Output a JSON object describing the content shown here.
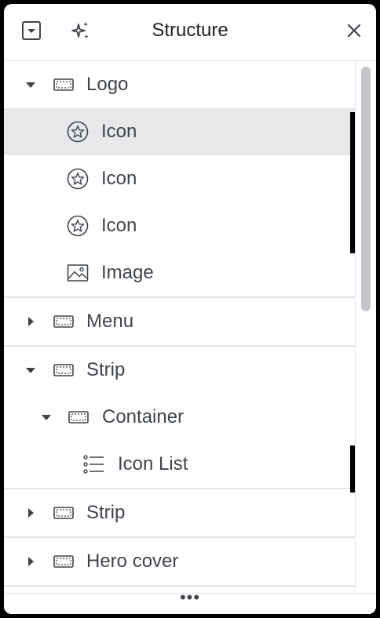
{
  "header": {
    "title": "Structure",
    "left_icon": "collapse-all-icon",
    "ai_icon": "sparkles-icon",
    "close_icon": "close-icon"
  },
  "tree": {
    "items": [
      {
        "label": "Logo",
        "icon": "container-icon",
        "expanded": true
      },
      {
        "label": "Icon",
        "icon": "star-icon",
        "selected": true
      },
      {
        "label": "Icon",
        "icon": "star-icon"
      },
      {
        "label": "Icon",
        "icon": "star-icon"
      },
      {
        "label": "Image",
        "icon": "image-icon"
      },
      {
        "label": "Menu",
        "icon": "container-icon",
        "expanded": false
      },
      {
        "label": "Strip",
        "icon": "container-icon",
        "expanded": true
      },
      {
        "label": "Container",
        "icon": "container-icon",
        "expanded": true
      },
      {
        "label": "Icon List",
        "icon": "list-icon"
      },
      {
        "label": "Strip",
        "icon": "container-icon",
        "expanded": false
      },
      {
        "label": "Hero cover",
        "icon": "container-icon",
        "expanded": false
      }
    ]
  },
  "footer": {
    "more_label": "•••"
  },
  "colors": {
    "selected_bg": "#e6e8ea",
    "text": "#3f444b",
    "border": "#e3e3e6"
  }
}
